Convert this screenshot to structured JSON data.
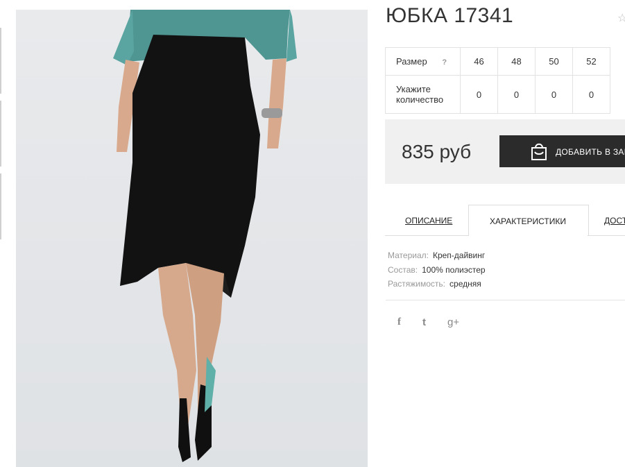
{
  "product": {
    "title": "ЮБКА 17341",
    "image_alt": "woman-in-black-wrap-skirt-photo"
  },
  "sizes_table": {
    "size_label": "Размер",
    "size_help": "?",
    "qty_label_line1": "Укажите",
    "qty_label_line2": "количество",
    "sizes": [
      "46",
      "48",
      "50",
      "52"
    ],
    "quantities": [
      "0",
      "0",
      "0",
      "0"
    ]
  },
  "purchase": {
    "price": "835 руб",
    "add_to_cart_label": "ДОБАВИТЬ В ЗАКАЗ"
  },
  "tabs": {
    "description": "ОПИСАНИЕ",
    "characteristics": "ХАРАКТЕРИСТИКИ",
    "delivery": "ДОСТАВКА"
  },
  "characteristics": [
    {
      "key": "Материал:",
      "value": "Креп-дайвинг"
    },
    {
      "key": "Состав:",
      "value": "100% полиэстер"
    },
    {
      "key": "Растяжимость:",
      "value": "средняя"
    }
  ],
  "social": {
    "facebook": "f",
    "twitter": "t",
    "google": "g+"
  },
  "colors": {
    "button_bg": "#2b2b2b",
    "price_box_bg": "#f0f0f0"
  },
  "icons": [
    "star-icon",
    "question-icon",
    "shopping-bag-icon",
    "facebook-icon",
    "twitter-icon",
    "google-plus-icon"
  ]
}
